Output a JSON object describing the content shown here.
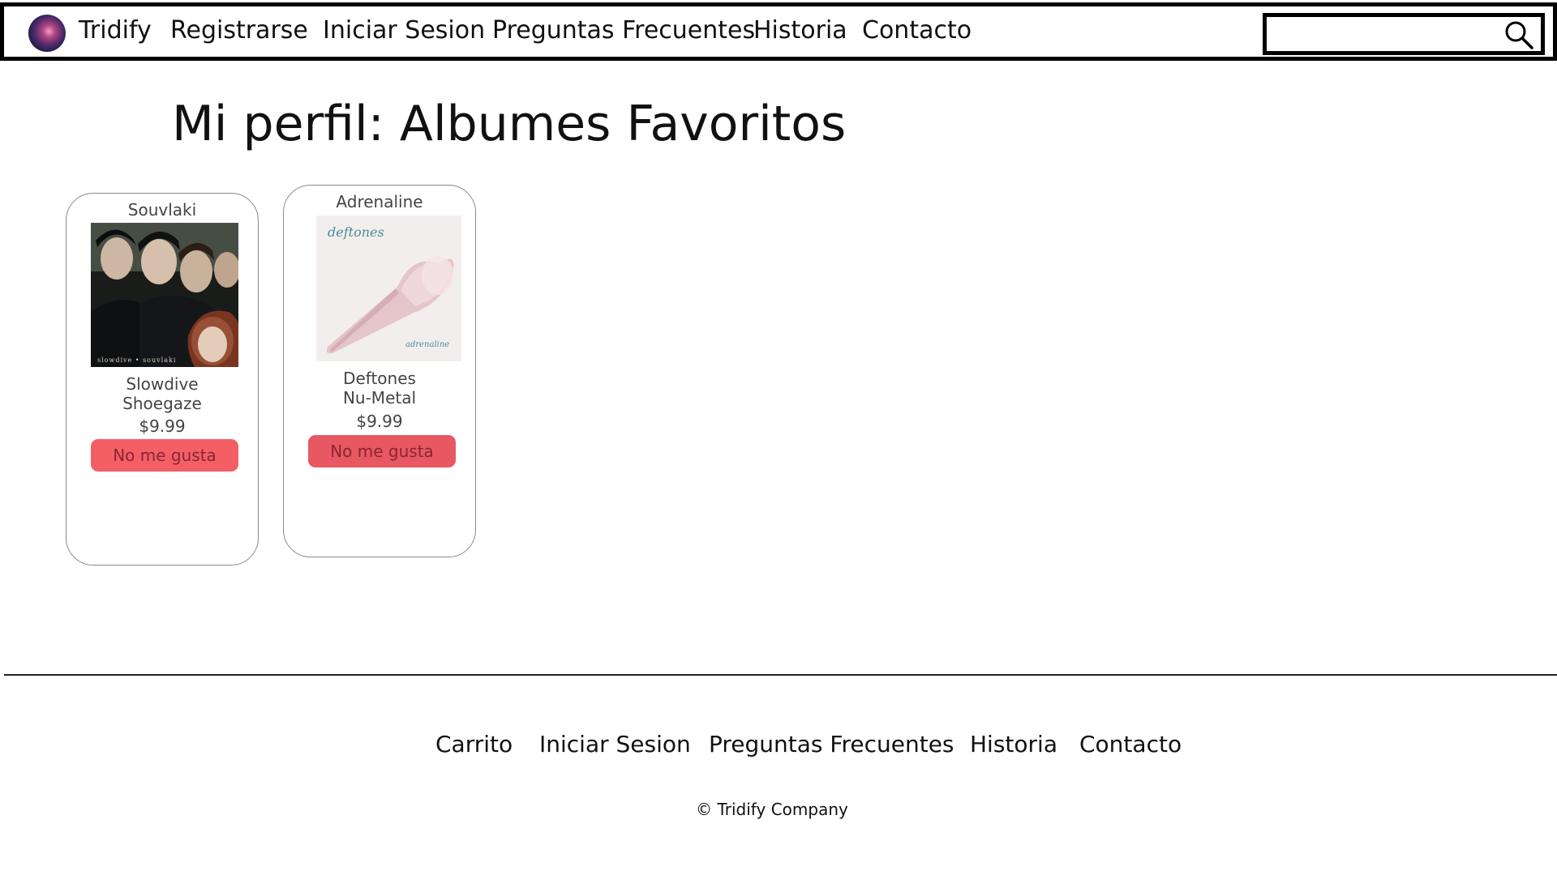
{
  "header": {
    "brand": "Tridify",
    "nav": [
      "Registrarse",
      "Iniciar Sesion",
      "Preguntas Frecuentes",
      "Historia",
      "Contacto"
    ],
    "search": {
      "value": "",
      "placeholder": ""
    }
  },
  "page": {
    "title": "Mi perfil: Albumes Favoritos"
  },
  "albums": [
    {
      "title": "Souvlaki",
      "artist": "Slowdive",
      "genre": "Shoegaze",
      "price": "$9.99",
      "button": "No me gusta",
      "cover_text": "slowdive • souvlaki",
      "button_color": "#f45f66"
    },
    {
      "title": "Adrenaline",
      "artist": "Deftones",
      "genre": "Nu-Metal",
      "price": "$9.99",
      "button": "No me gusta",
      "cover_text_top": "deftones",
      "cover_text_bottom": "adrenaline",
      "button_color": "#e85862"
    }
  ],
  "footer": {
    "links": [
      "Carrito",
      "Iniciar Sesion",
      "Preguntas Frecuentes",
      "Historia",
      "Contacto"
    ],
    "copyright": "© Tridify Company"
  },
  "colors": {
    "border": "#000000",
    "card_border": "#8a8a8a",
    "button_bg": "#f45f66"
  }
}
